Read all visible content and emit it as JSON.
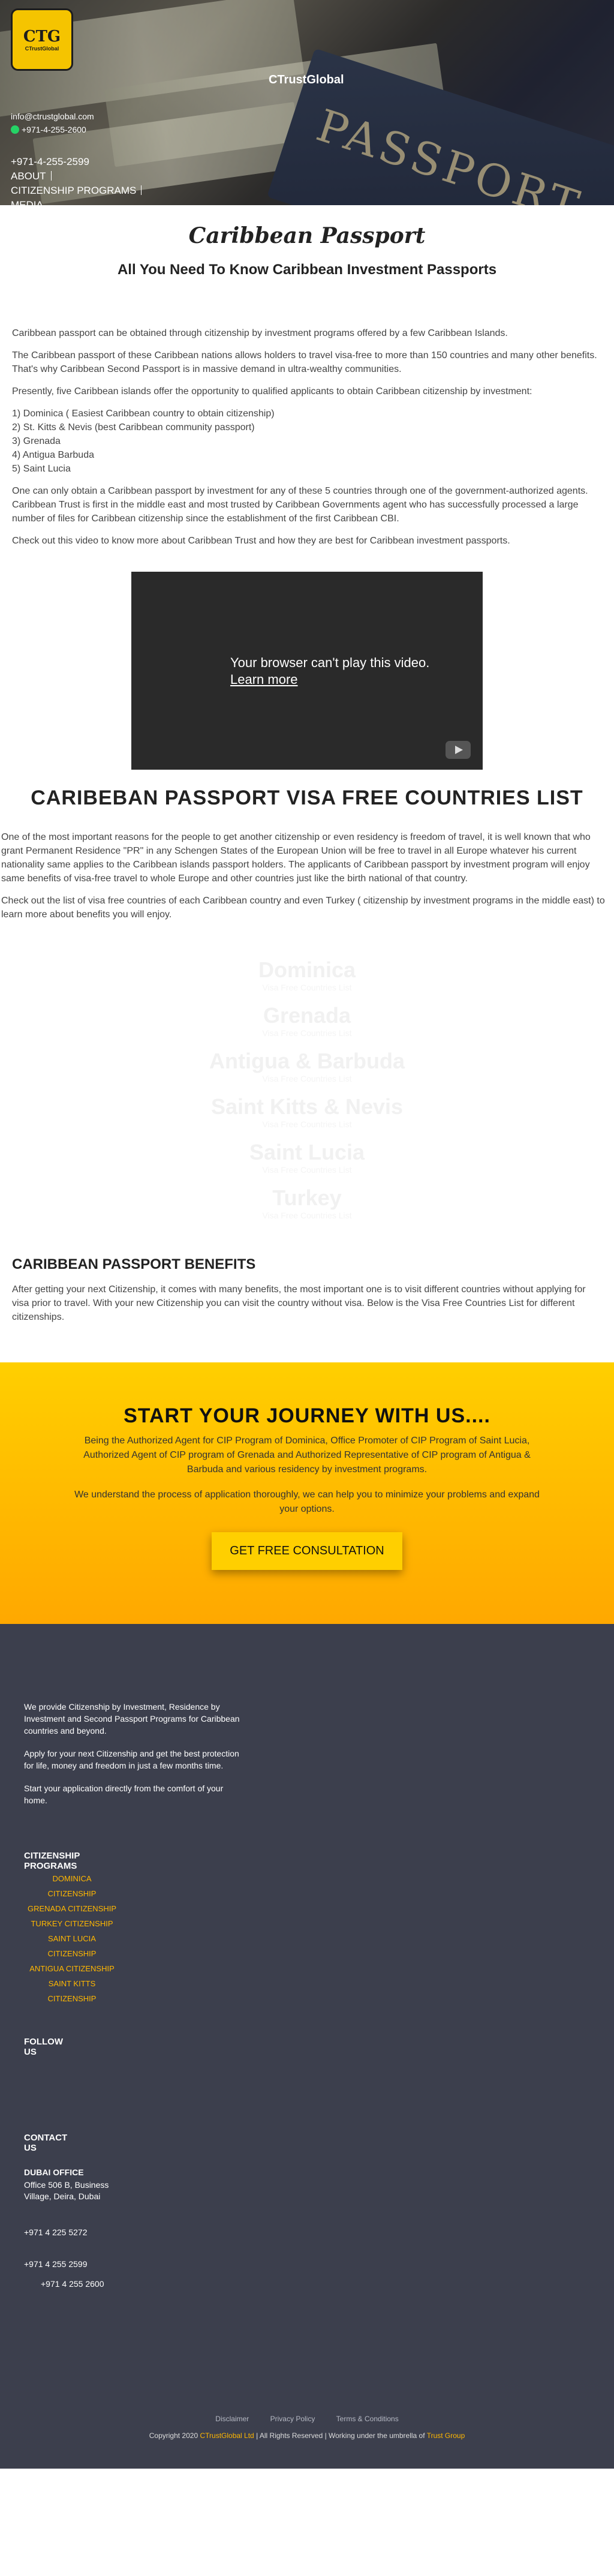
{
  "header": {
    "brand": "CTrustGlobal",
    "logo_text": "CTG",
    "logo_sub": "CTrustGlobal",
    "email": "info@ctrustglobal.com",
    "phone": "+971-4-255-2599",
    "whatsapp": "+971-4-255-2600",
    "background_word": "PASSPORT",
    "nav": [
      "ABOUT",
      "CITIZENSHIP PROGRAMS",
      "MEDIA"
    ]
  },
  "main": {
    "title": "Caribbean Passport",
    "subtitle": "All You Need To Know Caribbean Investment Passports",
    "paragraphs": [
      "Caribbean passport can be obtained through citizenship by investment programs offered by a few Caribbean Islands.",
      "The Caribbean passport of these Caribbean nations allows holders to travel visa-free to more than 150 countries and many other benefits. That's why Caribbean Second Passport is in massive demand in ultra-wealthy communities.",
      "Presently, five Caribbean islands offer the opportunity to qualified applicants to obtain Caribbean citizenship by investment:"
    ],
    "island_list": [
      "1) Dominica ( Easiest Caribbean country to obtain citizenship)",
      "2) St. Kitts & Nevis (best Caribbean community passport)",
      "3) Grenada",
      "4) Antigua Barbuda",
      "5) Saint Lucia"
    ],
    "paragraphs_after": [
      "One can only obtain a Caribbean passport by investment for any of these 5 countries through one of the government-authorized agents. Caribbean Trust is first in the middle east and most trusted by Caribbean Governments agent who has successfully processed a large number of files for Caribbean citizenship since the establishment of the first Caribbean CBI.",
      "Check out this video to know more about Caribbean Trust and how they are best for Caribbean investment passports."
    ],
    "video_message": "Your browser can't play this video.",
    "video_link": "Learn more",
    "visa_title": "CARIBEBAN PASSPORT VISA FREE COUNTRIES LIST",
    "visa_paragraphs": [
      "One of the most important reasons for the people to get another citizenship or even residency is freedom of travel, it is well known that who grant Permanent Residence \"PR\" in any Schengen States of the European Union will be free to travel in all Europe whatever his current nationality same applies to the Caribbean islands passport holders.  The applicants of Caribbean passport by investment program will enjoy same benefits of visa-free travel to whole Europe and other countries just like the birth national of that country.",
      "Check out the list of visa free countries of each Caribbean country and even Turkey ( citizenship by investment programs in the middle east) to learn more about benefits you will enjoy."
    ],
    "countries": [
      {
        "name": "Dominica",
        "sub": "Visa Free Countries List"
      },
      {
        "name": "Grenada",
        "sub": "Visa Free Countries List"
      },
      {
        "name": "Antigua & Barbuda",
        "sub": "Visa Free Countries List"
      },
      {
        "name": "Saint Kitts & Nevis",
        "sub": "Visa Free Countries List"
      },
      {
        "name": "Saint Lucia",
        "sub": "Visa Free Countries List"
      },
      {
        "name": "Turkey",
        "sub": "Visa Free Countries List"
      }
    ],
    "benefits_title": "CARIBBEAN PASSPORT BENEFITS",
    "benefits_text": "After getting your next Citizenship, it comes with many benefits, the most important one is to visit different countries without applying for visa prior to travel. With your new Citizenship you can visit the country without visa. Below is the Visa Free Countries List for different citizenships."
  },
  "cta": {
    "title": "START YOUR JOURNEY WITH US....",
    "text1": "Being the Authorized Agent for CIP Program of Dominica, Office Promoter of CIP Program of Saint Lucia, Authorized Agent of CIP program of Grenada and Authorized Representative of CIP program of Antigua & Barbuda and various residency by investment programs.",
    "text2": "We understand the process of application thoroughly, we can help you to minimize your problems and expand your options.",
    "button": "GET FREE CONSULTATION"
  },
  "footer": {
    "about": [
      "We provide Citizenship by Investment, Residence by Investment and Second Passport Programs for Caribbean countries and beyond.",
      "Apply for your next Citizenship and get the best protection for life, money and freedom in just a few months time.",
      "Start your application directly from the comfort of your home."
    ],
    "programs_heading": "CITIZENSHIP PROGRAMS",
    "programs": [
      "DOMINICA",
      "CITIZENSHIP",
      "GRENADA CITIZENSHIP",
      "TURKEY CITIZENSHIP",
      "SAINT LUCIA",
      "CITIZENSHIP",
      "ANTIGUA CITIZENSHIP",
      "SAINT KITTS",
      "CITIZENSHIP"
    ],
    "follow_heading": "FOLLOW US",
    "contact_heading": "CONTACT US",
    "office_title": "DUBAI OFFICE",
    "office_address": "Office 506 B, Business Village, Deira, Dubai",
    "fax": "+971 4 225 5272",
    "phone1": "+971 4 255 2599",
    "phone2": "+971 4 255 2600",
    "bottom_links": [
      "Disclaimer",
      "Privacy Policy",
      "Terms & Conditions"
    ],
    "copyright_pre": "Copyright 2020",
    "copyright_brand": "CTrustGlobal Ltd",
    "copyright_mid": "| All Rights Reserved | Working under the umbrella of",
    "copyright_parent": "Trust Group"
  }
}
